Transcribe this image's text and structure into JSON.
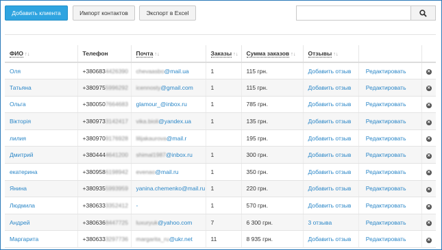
{
  "toolbar": {
    "add_client": "Добавить клиента",
    "import_contacts": "Импорт контактов",
    "export_excel": "Экспорт в Excel"
  },
  "search": {
    "placeholder": "",
    "value": ""
  },
  "columns": {
    "name": "ФИО",
    "phone": "Телефон",
    "email": "Почта",
    "orders": "Заказы",
    "orders_sum": "Сумма заказов",
    "reviews": "Отзывы",
    "sort_glyph": "↑↓"
  },
  "rows": [
    {
      "name": "Оля",
      "phone": "+380683",
      "phone_hidden": "4426390",
      "email_hidden": "chevaasbo",
      "email": "@mail.ua",
      "orders": "1",
      "sum": "115 грн.",
      "review": "Добавить отзыв",
      "edit": "Редактировать"
    },
    {
      "name": "Татьяна",
      "phone": "+380975",
      "phone_hidden": "5996292",
      "email_hidden": "icennosty",
      "email": "@gmail.com",
      "orders": "1",
      "sum": "115 грн.",
      "review": "Добавить отзыв",
      "edit": "Редактировать"
    },
    {
      "name": "Ольга",
      "phone": "+380050",
      "phone_hidden": "7664683",
      "email_hidden": "",
      "email": "glamour_@inbox.ru",
      "orders": "1",
      "sum": "785 грн.",
      "review": "Добавить отзыв",
      "edit": "Редактировать"
    },
    {
      "name": "Вікторія",
      "phone": "+380973",
      "phone_hidden": "3142417",
      "email_hidden": "vika.bioli",
      "email": "@yandex.ua",
      "orders": "1",
      "sum": "135 грн.",
      "review": "Добавить отзыв",
      "edit": "Редактировать"
    },
    {
      "name": "лилия",
      "phone": "+380970",
      "phone_hidden": "9176928",
      "email_hidden": "lilijakaurova",
      "email": "@mail.r",
      "orders": "",
      "sum": "195 грн.",
      "review": "Добавить отзыв",
      "edit": "Редактировать"
    },
    {
      "name": "Дмитрий",
      "phone": "+380444",
      "phone_hidden": "4641200",
      "email_hidden": "shimal1987",
      "email": "@inbox.ru",
      "orders": "1",
      "sum": "300 грн.",
      "review": "Добавить отзыв",
      "edit": "Редактировать"
    },
    {
      "name": "екатерина",
      "phone": "+380958",
      "phone_hidden": "6198942",
      "email_hidden": "evenao",
      "email": "@mail.ru",
      "orders": "1",
      "sum": "350 грн.",
      "review": "Добавить отзыв",
      "edit": "Редактировать"
    },
    {
      "name": "Янина",
      "phone": "+380935",
      "phone_hidden": "5993959",
      "email_hidden": "",
      "email": "yanina.chemenko@mail.ru",
      "orders": "1",
      "sum": "220 грн.",
      "review": "Добавить отзыв",
      "edit": "Редактировать"
    },
    {
      "name": "Людмила",
      "phone": "+380633",
      "phone_hidden": "3352412",
      "email_hidden": "",
      "email": "-",
      "orders": "1",
      "sum": "570 грн.",
      "review": "Добавить отзыв",
      "edit": "Редактировать"
    },
    {
      "name": "Андрей",
      "phone": "+380636",
      "phone_hidden": "8447725",
      "email_hidden": "luxuryuk",
      "email": "@yahoo.com",
      "orders": "7",
      "sum": "6 300 грн.",
      "review": "3 отзыва",
      "edit": "Редактировать"
    },
    {
      "name": "Маргарита",
      "phone": "+380633",
      "phone_hidden": "3297736",
      "email_hidden": "margarita_ru",
      "email": "@ukr.net",
      "orders": "11",
      "sum": "8 935 грн.",
      "review": "Добавить отзыв",
      "edit": "Редактировать"
    }
  ],
  "icons": {
    "search": "search-icon",
    "delete": "delete-icon"
  },
  "colors": {
    "primary": "#2fa4e0",
    "link": "#2a86c7",
    "frame": "#2a78b8"
  }
}
